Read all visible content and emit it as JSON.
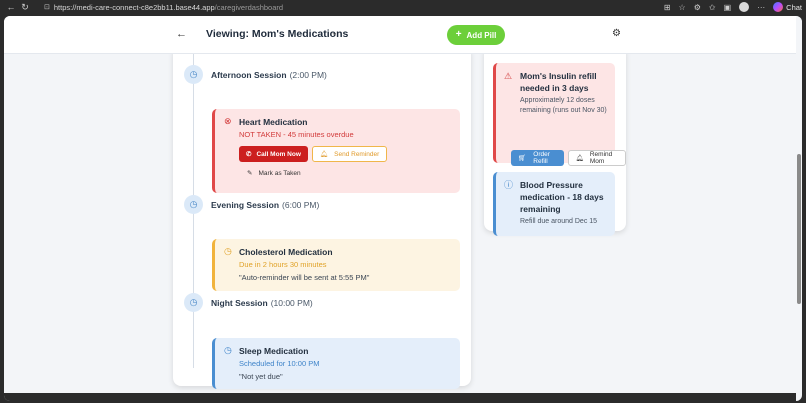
{
  "browser": {
    "url_host": "https://medi-care-connect-c8e2bb11.base44.app",
    "url_path": "/caregiverdashboard",
    "chat_label": "Chat"
  },
  "header": {
    "title": "Viewing: Mom's Medications",
    "add_pill_label": "Add Pill"
  },
  "schedule": {
    "sessions": [
      {
        "name": "Afternoon Session",
        "time": "(2:00 PM)"
      },
      {
        "name": "Evening Session",
        "time": "(6:00 PM)"
      },
      {
        "name": "Night Session",
        "time": "(10:00 PM)"
      }
    ],
    "heart": {
      "name": "Heart Medication",
      "status": "NOT TAKEN - 45 minutes overdue",
      "call_label": "Call Mom Now",
      "remind_label": "Send Reminder",
      "mark_label": "Mark as Taken"
    },
    "cholesterol": {
      "name": "Cholesterol Medication",
      "status": "Due in 2 hours 30 minutes",
      "note": "\"Auto-reminder will be sent at 5:55 PM\""
    },
    "sleep": {
      "name": "Sleep Medication",
      "status": "Scheduled for 10:00 PM",
      "note": "\"Not yet due\""
    }
  },
  "alerts": {
    "insulin": {
      "title": "Mom's Insulin refill needed in 3 days",
      "desc": "Approximately 12 doses remaining (runs out Nov 30)",
      "order_label": "Order Refill",
      "remind_label": "Remind Mom"
    },
    "bp": {
      "title": "Blood Pressure medication - 18 days remaining",
      "desc": "Refill due around Dec 15"
    }
  },
  "colors": {
    "accent_green": "#6ccf3a",
    "alert_red": "#d23b3b",
    "warning_amber": "#e0a228",
    "info_blue": "#3f84c9"
  }
}
